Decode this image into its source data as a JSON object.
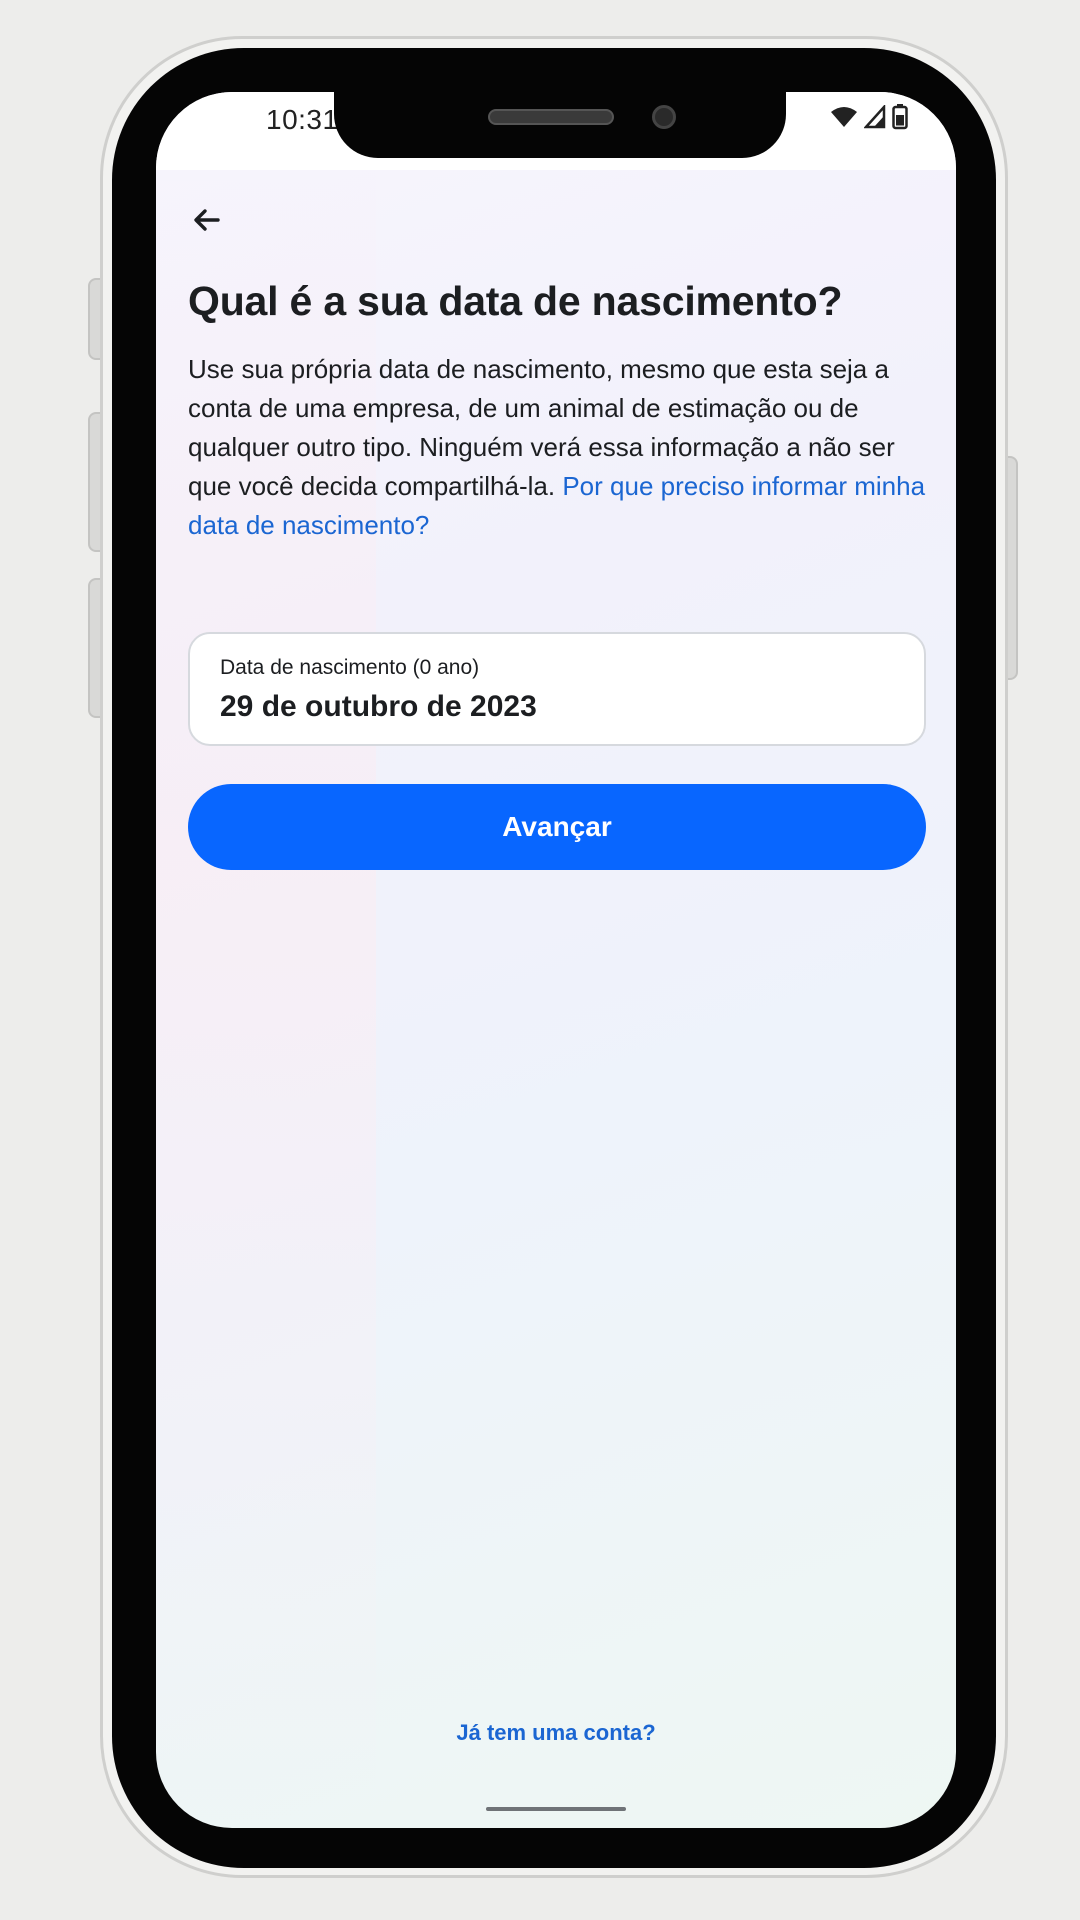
{
  "statusbar": {
    "time": "10:31",
    "icons": [
      "wifi-icon",
      "signal-icon",
      "battery-icon"
    ]
  },
  "header": {
    "back_icon": "arrow-left-icon",
    "title": "Qual é a sua data de nascimento?"
  },
  "description": {
    "text": "Use sua própria data de nascimento, mesmo que esta seja a conta de uma empresa, de um animal de estimação ou de qualquer outro tipo. Ninguém verá essa informação a não ser que você decida compartilhá-la.",
    "link": "Por que preciso informar minha data de nascimento?"
  },
  "birthday_field": {
    "label": "Data de nascimento (0 ano)",
    "value": "29 de outubro de 2023"
  },
  "next_button": {
    "label": "Avançar"
  },
  "footer": {
    "login_link": "Já tem uma conta?"
  },
  "colors": {
    "primary": "#0866ff",
    "link": "#1b66d2",
    "text": "#1c1e21",
    "frame": "#050505"
  }
}
